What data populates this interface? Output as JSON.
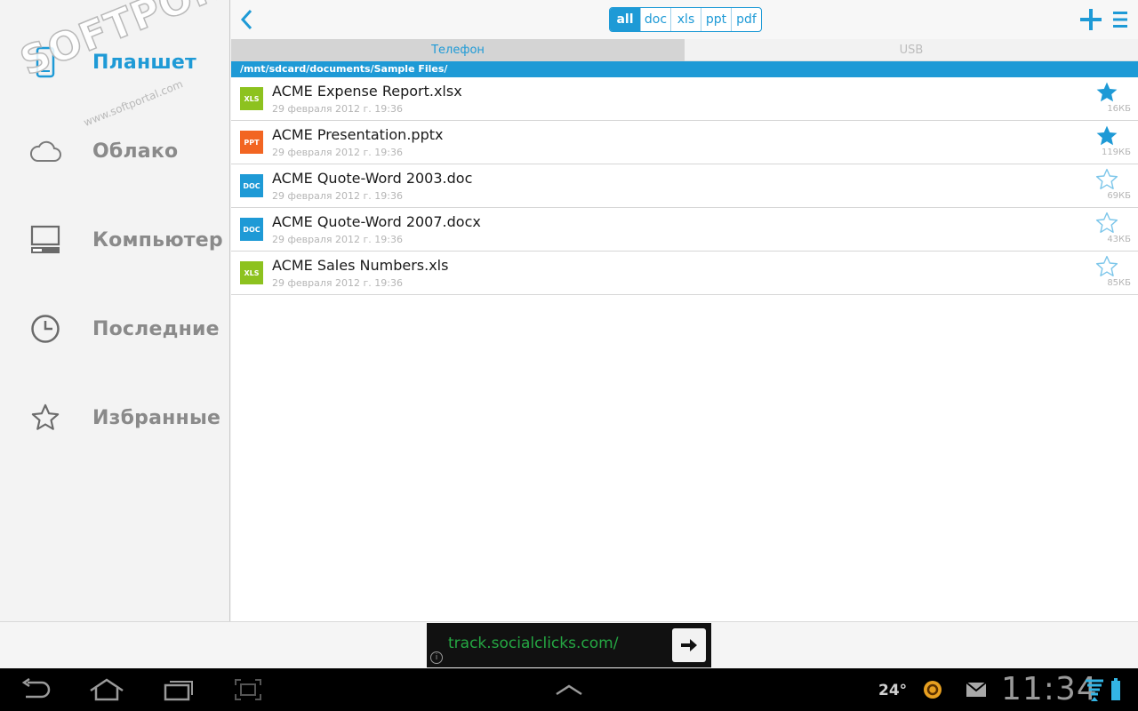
{
  "sidebar": {
    "items": [
      {
        "label": "Планшет",
        "icon": "tablet-icon",
        "active": true
      },
      {
        "label": "Облако",
        "icon": "cloud-icon"
      },
      {
        "label": "Компьютер",
        "icon": "computer-icon"
      },
      {
        "label": "Последние",
        "icon": "clock-icon"
      },
      {
        "label": "Избранные",
        "icon": "star-icon"
      }
    ]
  },
  "toolbar": {
    "filters": [
      "all",
      "doc",
      "xls",
      "ppt",
      "pdf"
    ],
    "active_filter": "all"
  },
  "tabs": [
    "Телефон",
    "USB"
  ],
  "path": "/mnt/sdcard/documents/Sample Files/",
  "files": [
    {
      "name": "ACME Expense Report.xlsx",
      "date": "29 февраля 2012 г. 19:36",
      "size": "16КБ",
      "type": "XLS",
      "type_color": "#8dc21f",
      "starred": true
    },
    {
      "name": "ACME Presentation.pptx",
      "date": "29 февраля 2012 г. 19:36",
      "size": "119КБ",
      "type": "PPT",
      "type_color": "#f26522",
      "starred": true
    },
    {
      "name": "ACME Quote-Word 2003.doc",
      "date": "29 февраля 2012 г. 19:36",
      "size": "69КБ",
      "type": "DOC",
      "type_color": "#1e9ad6",
      "starred": false
    },
    {
      "name": "ACME Quote-Word 2007.docx",
      "date": "29 февраля 2012 г. 19:36",
      "size": "43КБ",
      "type": "DOC",
      "type_color": "#1e9ad6",
      "starred": false
    },
    {
      "name": "ACME Sales Numbers.xls",
      "date": "29 февраля 2012 г. 19:36",
      "size": "85КБ",
      "type": "XLS",
      "type_color": "#8dc21f",
      "starred": false
    }
  ],
  "ad": {
    "text": "track.socialclicks.com/",
    "info": "i"
  },
  "status": {
    "temperature": "24°",
    "time": "11:34"
  },
  "watermark": {
    "text": "SOFTPORTAL",
    "sub": "www.softportal.com"
  },
  "colors": {
    "accent": "#1e9ad6",
    "ad_text": "#25a843"
  }
}
